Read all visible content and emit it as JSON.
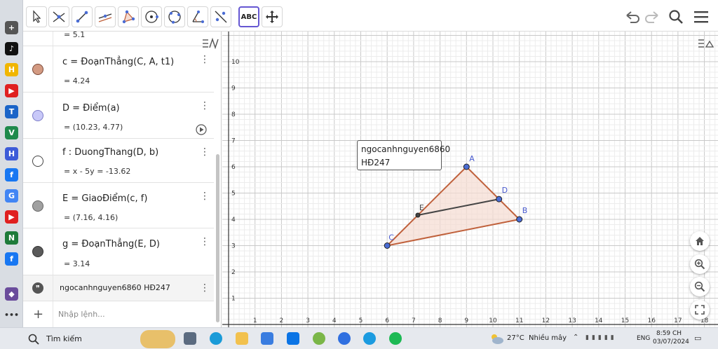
{
  "toolbar": {
    "tools": [
      {
        "name": "move-tool-button",
        "icon": "arrow-pointer-icon"
      },
      {
        "name": "point-on-intersection-tool-button",
        "icon": "intersect-icon"
      },
      {
        "name": "segment-tool-button",
        "icon": "segment-icon"
      },
      {
        "name": "parallel-line-tool-button",
        "icon": "parallel-line-icon"
      },
      {
        "name": "polygon-tool-button",
        "icon": "polygon-icon"
      },
      {
        "name": "circle-tool-button",
        "icon": "circle-center-icon"
      },
      {
        "name": "circle-three-points-tool-button",
        "icon": "circle-three-points-icon"
      },
      {
        "name": "angle-tool-button",
        "icon": "angle-icon"
      },
      {
        "name": "reflect-tool-button",
        "icon": "reflect-line-icon"
      },
      {
        "name": "text-tool-button",
        "icon": "text-icon",
        "label": "ABC"
      },
      {
        "name": "move-graphics-tool-button",
        "icon": "move-cross-icon"
      }
    ]
  },
  "algebra": {
    "rows": [
      {
        "value": "= 5.1"
      },
      {
        "color": "#d39a82",
        "definition": "c = ĐoạnThẳng(C, A, t1)",
        "value": "= 4.24"
      },
      {
        "color": "#c8c8f8",
        "definition": "D = Điểm(a)",
        "value": "= (10.23, 4.77)"
      },
      {
        "color": "#ffffff",
        "definition": "f : DuongThang(D, b)",
        "value": "= x - 5y = -13.62"
      },
      {
        "color": "#a0a0a0",
        "definition": "E = GiaoĐiểm(c, f)",
        "value": "= (7.16, 4.16)"
      },
      {
        "color": "#5a5a5a",
        "definition": "g = ĐoạnThẳng(E, D)",
        "value": "= 3.14"
      },
      {
        "text": "ngocanhnguyen6860  HĐ247"
      }
    ],
    "input_placeholder": "Nhập lệnh..."
  },
  "graphics": {
    "x_ticks": [
      "1",
      "2",
      "3",
      "4",
      "5",
      "6",
      "7",
      "8",
      "9",
      "10",
      "11",
      "12",
      "13",
      "14",
      "15",
      "16",
      "17",
      "18"
    ],
    "y_ticks": [
      "1",
      "2",
      "3",
      "4",
      "5",
      "6",
      "7",
      "8",
      "9",
      "10"
    ],
    "textbox": [
      "ngocanhnguyen6860",
      "HĐ247"
    ],
    "points": {
      "A": "A",
      "B": "B",
      "C": "C",
      "D": "D",
      "E": "E"
    }
  },
  "chart_data": {
    "type": "scatter",
    "xlim": [
      0,
      18.6
    ],
    "ylim": [
      0,
      11
    ],
    "grid": true,
    "points": [
      {
        "name": "A",
        "x": 9,
        "y": 6
      },
      {
        "name": "B",
        "x": 11,
        "y": 4
      },
      {
        "name": "C",
        "x": 6,
        "y": 3
      },
      {
        "name": "D",
        "x": 10.23,
        "y": 4.77
      },
      {
        "name": "E",
        "x": 7.16,
        "y": 4.16
      }
    ],
    "polygon": [
      "A",
      "B",
      "C"
    ],
    "segments": [
      [
        "E",
        "D"
      ]
    ],
    "colors": {
      "triangle": "#c0613c",
      "fill": "#f5dcd2",
      "segment_g": "#444444",
      "point": "#4a6cd4"
    }
  },
  "taskbar": {
    "search_label": "Tìm kiếm",
    "weather_temp": "27°C",
    "weather_desc": "Nhiều mây",
    "lang": "ENG",
    "time": "8:59 CH",
    "date": "03/07/2024"
  }
}
